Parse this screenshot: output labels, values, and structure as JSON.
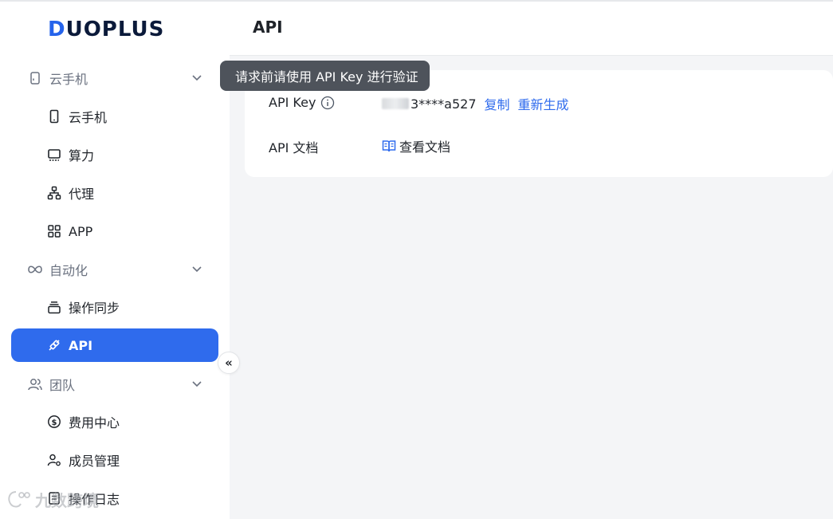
{
  "app": {
    "logo_text": "DUOPLUS",
    "logo_first": "D",
    "logo_rest": "UOPLUS"
  },
  "sidebar": {
    "groups": [
      {
        "label": "云手机",
        "icon": "phone-outline-icon"
      },
      {
        "label": "自动化",
        "icon": "infinity-icon"
      },
      {
        "label": "团队",
        "icon": "users-icon"
      }
    ],
    "items": [
      {
        "label": "云手机",
        "icon": "phone-icon"
      },
      {
        "label": "算力",
        "icon": "monitor-icon"
      },
      {
        "label": "代理",
        "icon": "network-icon"
      },
      {
        "label": "APP",
        "icon": "apps-grid-icon"
      },
      {
        "label": "操作同步",
        "icon": "sync-stack-icon"
      },
      {
        "label": "API",
        "icon": "plug-icon",
        "active": true
      },
      {
        "label": "费用中心",
        "icon": "dollar-circle-icon"
      },
      {
        "label": "成员管理",
        "icon": "user-gear-icon"
      },
      {
        "label": "操作日志",
        "icon": "log-icon"
      }
    ],
    "collapse_label": "«"
  },
  "header": {
    "title": "API"
  },
  "tooltip": {
    "text": "请求前请使用 API Key 进行验证"
  },
  "api": {
    "key_label": "API Key",
    "key_visible": "3****a527",
    "copy_label": "复制",
    "regenerate_label": "重新生成",
    "doc_label": "API 文档",
    "doc_link_label": "查看文档"
  },
  "watermark": {
    "text": "九数跨境"
  },
  "colors": {
    "accent": "#2f6bed",
    "sidebar_bg": "#ffffff",
    "page_bg": "#f4f5f7",
    "tooltip_bg": "#4e535b"
  }
}
